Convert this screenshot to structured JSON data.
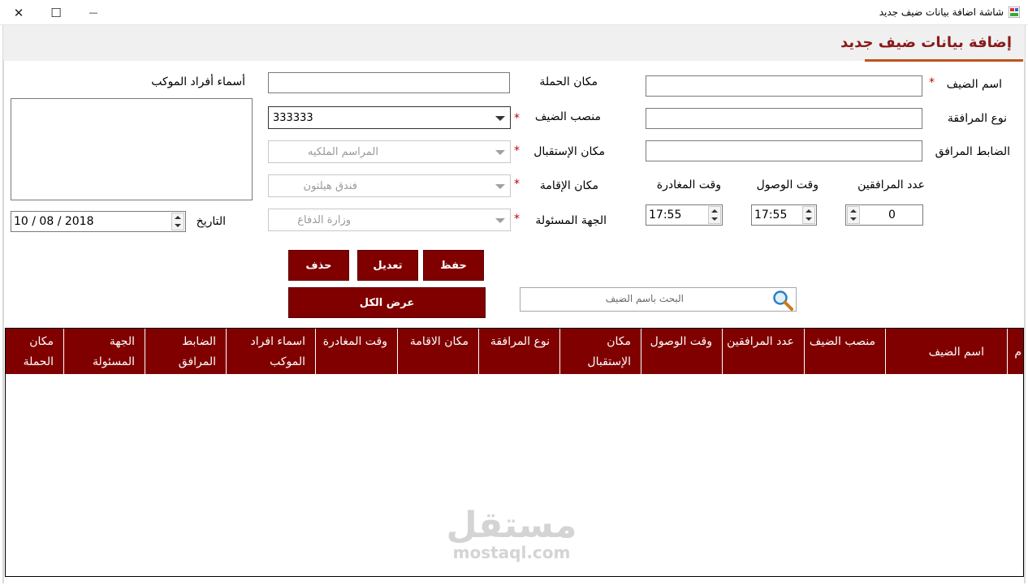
{
  "window": {
    "title": "شاشة اضافة بيانات ضيف جديد",
    "close_glyph": "✕",
    "maximize_glyph": "☐",
    "minimize_glyph": "—"
  },
  "header": {
    "title": "إضافة بيانات ضيف جديد"
  },
  "form": {
    "guest_name_label": "اسم الضيف",
    "companion_type_label": "نوع المرافقة",
    "escort_officer_label": "الضابط المرافق",
    "companions_count_label": "عدد المرافقين",
    "arrival_time_label": "وقت الوصول",
    "departure_time_label": "وقت المغادرة",
    "campaign_place_label": "مكان الحملة",
    "guest_position_label": "منصب الضيف",
    "reception_place_label": "مكان الإستقبال",
    "residence_place_label": "مكان الإقامة",
    "responsible_party_label": "الجهة المسئولة",
    "convoy_members_label": "أسماء أفراد الموكب",
    "date_label": "التاريخ",
    "required_mark": "*",
    "guest_position_value": "333333",
    "reception_place_value": "المراسم الملكيه",
    "residence_place_value": "فندق هيلتون",
    "responsible_party_value": "وزارة الدفاع",
    "companions_count_value": "0",
    "arrival_time_value": "17:55",
    "departure_time_value": "17:55",
    "date_value": "10 / 08 / 2018"
  },
  "buttons": {
    "save": "حفظ",
    "edit": "تعديل",
    "delete": "حذف",
    "show_all": "عرض الكل"
  },
  "search": {
    "placeholder": "البحث باسم الضيف",
    "icon": "magnifier-icon"
  },
  "grid": {
    "columns": [
      "م",
      "اسم الضيف",
      "منصب الضيف",
      "عدد المرافقين",
      "وقت الوصول",
      "مكان الإستقبال",
      "نوع المرافقة",
      "مكان الاقامة",
      "وقت المغادرة",
      "اسماء افراد الموكب",
      "الضابط المرافق",
      "الجهة المسئولة",
      "مكان الحملة"
    ],
    "rows": []
  },
  "watermark": {
    "arabic": "مستقل",
    "latin": "mostaql.com"
  },
  "colors": {
    "accent": "#800000",
    "header_title": "#8b1a1a",
    "header_underline": "#c0541c",
    "required": "#c00000"
  }
}
